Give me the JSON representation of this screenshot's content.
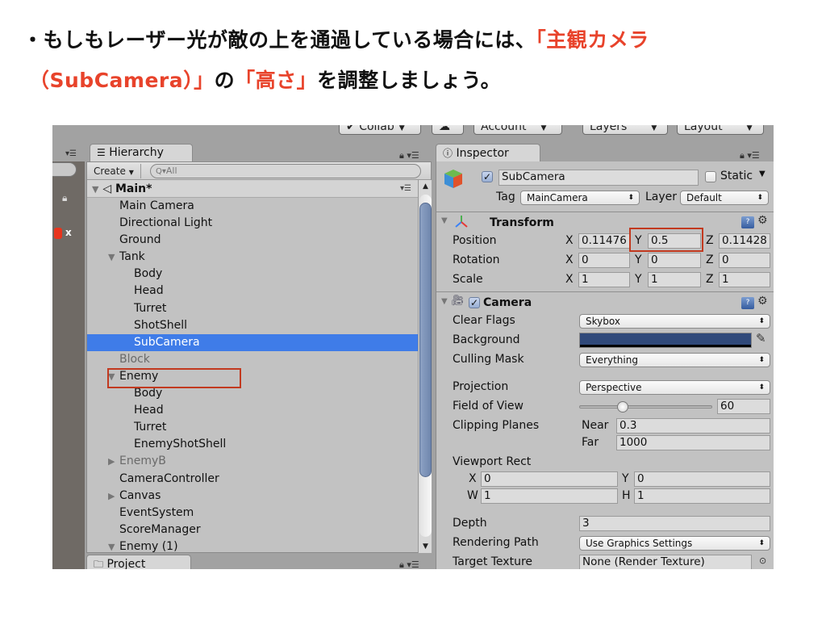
{
  "caption": {
    "line1_prefix": "・もしもレーザー光が敵の上を通過している場合には、",
    "line1_highlight": "「主観カメラ",
    "line2_highlight1": "（SubCamera）」",
    "line2_mid": "の",
    "line2_highlight2": "「高さ」",
    "line2_suffix": "を調整しましょう。",
    "highlight_color": "#e8432b"
  },
  "toolbar": {
    "collab": "Collab",
    "account": "Account",
    "layers": "Layers",
    "layout": "Layout"
  },
  "scene": {
    "axis_label": "x"
  },
  "hierarchy": {
    "tab_label": "Hierarchy",
    "create_label": "Create",
    "search_placeholder": "All",
    "scene_name": "Main*",
    "items": [
      {
        "label": "Main Camera",
        "depth": 0,
        "expand": "",
        "dim": false
      },
      {
        "label": "Directional Light",
        "depth": 0,
        "expand": "",
        "dim": false
      },
      {
        "label": "Ground",
        "depth": 0,
        "expand": "",
        "dim": false
      },
      {
        "label": "Tank",
        "depth": 0,
        "expand": "open",
        "dim": false
      },
      {
        "label": "Body",
        "depth": 1,
        "expand": "",
        "dim": false
      },
      {
        "label": "Head",
        "depth": 1,
        "expand": "",
        "dim": false
      },
      {
        "label": "Turret",
        "depth": 1,
        "expand": "",
        "dim": false
      },
      {
        "label": "ShotShell",
        "depth": 1,
        "expand": "",
        "dim": false
      },
      {
        "label": "SubCamera",
        "depth": 1,
        "expand": "",
        "dim": false,
        "selected": true
      },
      {
        "label": "Block",
        "depth": 0,
        "expand": "",
        "dim": true
      },
      {
        "label": "Enemy",
        "depth": 0,
        "expand": "open",
        "dim": false
      },
      {
        "label": "Body",
        "depth": 1,
        "expand": "",
        "dim": false
      },
      {
        "label": "Head",
        "depth": 1,
        "expand": "",
        "dim": false
      },
      {
        "label": "Turret",
        "depth": 1,
        "expand": "",
        "dim": false
      },
      {
        "label": "EnemyShotShell",
        "depth": 1,
        "expand": "",
        "dim": false
      },
      {
        "label": "EnemyB",
        "depth": 0,
        "expand": "closed",
        "dim": true
      },
      {
        "label": "CameraController",
        "depth": 0,
        "expand": "",
        "dim": false
      },
      {
        "label": "Canvas",
        "depth": 0,
        "expand": "closed",
        "dim": false
      },
      {
        "label": "EventSystem",
        "depth": 0,
        "expand": "",
        "dim": false
      },
      {
        "label": "ScoreManager",
        "depth": 0,
        "expand": "",
        "dim": false
      },
      {
        "label": "Enemy (1)",
        "depth": 0,
        "expand": "open",
        "dim": false
      }
    ],
    "selected_color": "#3f7ce8"
  },
  "project": {
    "tab_label": "Project"
  },
  "inspector": {
    "tab_label": "Inspector",
    "object_name": "SubCamera",
    "active": true,
    "static_label": "Static",
    "static": false,
    "tag_label": "Tag",
    "tag_value": "MainCamera",
    "layer_label": "Layer",
    "layer_value": "Default",
    "transform": {
      "title": "Transform",
      "position_label": "Position",
      "rotation_label": "Rotation",
      "scale_label": "Scale",
      "position": {
        "x": "0.11476",
        "y": "0.5",
        "z": "0.11428"
      },
      "rotation": {
        "x": "0",
        "y": "0",
        "z": "0"
      },
      "scale": {
        "x": "1",
        "y": "1",
        "z": "1"
      }
    },
    "camera": {
      "title": "Camera",
      "enabled": true,
      "clear_flags_label": "Clear Flags",
      "clear_flags": "Skybox",
      "background_label": "Background",
      "background_color": "#30497a",
      "culling_mask_label": "Culling Mask",
      "culling_mask": "Everything",
      "projection_label": "Projection",
      "projection": "Perspective",
      "fov_label": "Field of View",
      "fov": "60",
      "fov_slider_fraction": 0.33,
      "clipping_label": "Clipping Planes",
      "near_label": "Near",
      "near": "0.3",
      "far_label": "Far",
      "far": "1000",
      "viewport_label": "Viewport Rect",
      "viewport": {
        "x": "0",
        "y": "0",
        "w": "1",
        "h": "1"
      },
      "depth_label": "Depth",
      "depth": "3",
      "rendering_path_label": "Rendering Path",
      "rendering_path": "Use Graphics Settings",
      "target_texture_label": "Target Texture",
      "target_texture": "None (Render Texture)"
    }
  }
}
